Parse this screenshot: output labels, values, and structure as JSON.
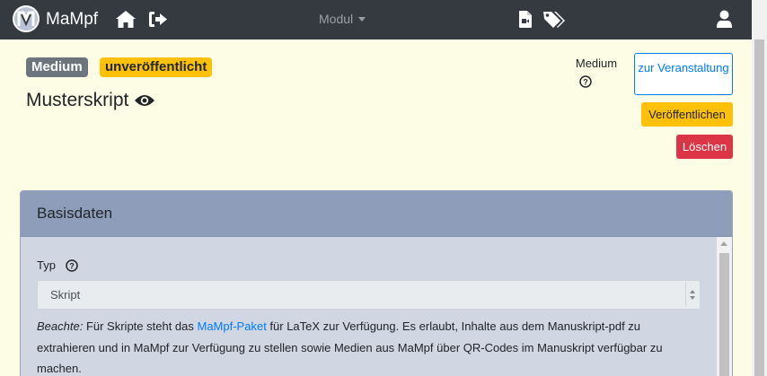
{
  "navbar": {
    "brand": "MaMpf",
    "logo_letter": "M",
    "module_menu": "Modul",
    "icons": [
      "home-icon",
      "logout-icon",
      "video-file-icon",
      "tags-icon",
      "user-icon"
    ]
  },
  "header": {
    "badge_medium": "Medium",
    "badge_status": "unveröffentlicht",
    "title": "Musterskript",
    "medium_label": "Medium",
    "btn_course": "zur Veranstaltung",
    "btn_publish": "Veröffentlichen",
    "btn_delete": "Löschen"
  },
  "card": {
    "title": "Basisdaten",
    "type_label": "Typ",
    "type_value": "Skript",
    "note_emph": "Beachte:",
    "note_pre": " Für Skripte steht das ",
    "note_link": "MaMpf-Paket",
    "note_post": " für LaTeX zur Verfügung. Es erlaubt, Inhalte aus dem Manuskript-pdf zu extrahieren und in MaMpf zur Verfügung zu stellen sowie Medien aus MaMpf über QR-Codes im Manuskript verfügbar zu machen."
  },
  "colors": {
    "navbar": "#343a40",
    "page_bg": "#fdfde6",
    "card_header": "#8e9db9",
    "card_body": "#d0d7e2",
    "primary": "#007bff",
    "warning": "#ffc107",
    "danger": "#dc3545",
    "secondary": "#6c757d"
  }
}
